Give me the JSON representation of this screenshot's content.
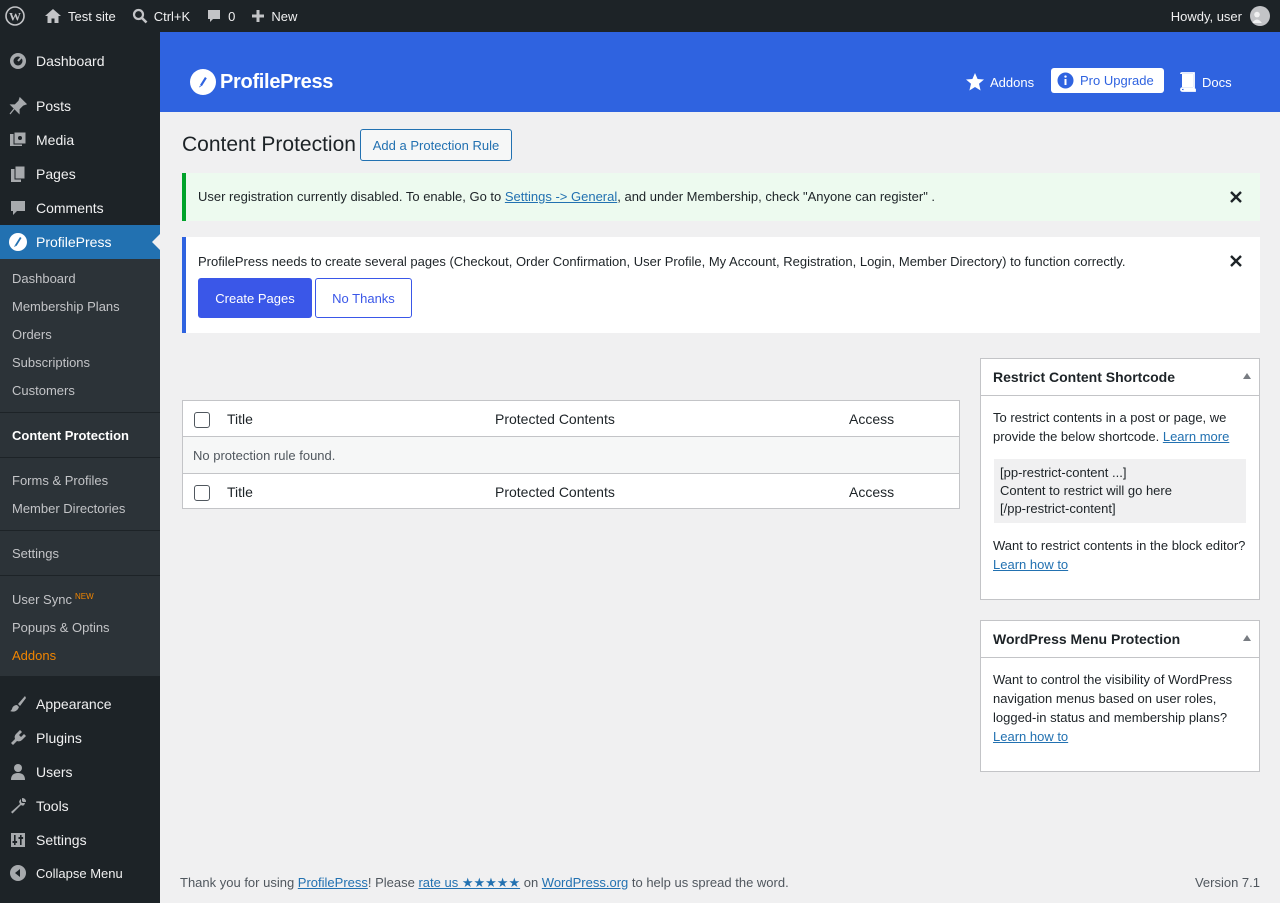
{
  "adminbar": {
    "site_name": "Test site",
    "search_shortcut": "Ctrl+K",
    "comments_count": "0",
    "new_label": "New",
    "greeting": "Howdy, user"
  },
  "sidebar": {
    "items": [
      {
        "label": "Dashboard"
      },
      {
        "label": "Posts"
      },
      {
        "label": "Media"
      },
      {
        "label": "Pages"
      },
      {
        "label": "Comments"
      },
      {
        "label": "ProfilePress"
      },
      {
        "label": "Appearance"
      },
      {
        "label": "Plugins"
      },
      {
        "label": "Users"
      },
      {
        "label": "Tools"
      },
      {
        "label": "Settings"
      },
      {
        "label": "Collapse Menu"
      }
    ],
    "submenu": [
      {
        "label": "Dashboard"
      },
      {
        "label": "Membership Plans"
      },
      {
        "label": "Orders"
      },
      {
        "label": "Subscriptions"
      },
      {
        "label": "Customers"
      },
      {
        "label": "Content Protection"
      },
      {
        "label": "Forms & Profiles"
      },
      {
        "label": "Member Directories"
      },
      {
        "label": "Settings"
      },
      {
        "label": "User Sync"
      },
      {
        "label": "Popups & Optins"
      },
      {
        "label": "Addons"
      }
    ],
    "new_badge": "NEW"
  },
  "header": {
    "logo": "ProfilePress",
    "addons": "Addons",
    "pro_upgrade": "Pro Upgrade",
    "docs": "Docs"
  },
  "page": {
    "title": "Content Protection",
    "add_rule_button": "Add a Protection Rule"
  },
  "notices": {
    "registration": {
      "before": "User registration currently disabled. To enable, Go to ",
      "link": "Settings -> General",
      "after": ", and under Membership, check \"Anyone can register\" ."
    },
    "pages": {
      "text": "ProfilePress needs to create several pages (Checkout, Order Confirmation, User Profile, My Account, Registration, Login, Member Directory) to function correctly.",
      "create_button": "Create Pages",
      "no_thanks_button": "No Thanks"
    }
  },
  "table": {
    "columns": [
      "Title",
      "Protected Contents",
      "Access"
    ],
    "empty_message": "No protection rule found."
  },
  "shortcode_box": {
    "title": "Restrict Content Shortcode",
    "intro": "To restrict contents in a post or page, we provide the below shortcode.",
    "learn_more": "Learn more",
    "code_lines": [
      "[pp-restrict-content ...]",
      "Content to restrict will go here",
      "[/pp-restrict-content]"
    ],
    "block_text": "Want to restrict contents in the block editor?",
    "learn_how": "Learn how to"
  },
  "menu_box": {
    "title": "WordPress Menu Protection",
    "text": "Want to control the visibility of WordPress navigation menus based on user roles, logged-in status and membership plans?",
    "learn_how": "Learn how to"
  },
  "footer": {
    "text_1": "Thank you for using ",
    "link_1": "ProfilePress",
    "text_2": "! Please ",
    "link_2": "rate us ★★★★★",
    "text_3": " on ",
    "link_3": "WordPress.org",
    "text_4": " to help us spread the word.",
    "version": "Version 7.1"
  },
  "colors": {
    "admin_dark": "#1d2327",
    "wp_blue": "#2271b1",
    "profilepress_blue": "#2f63e0",
    "addons_orange": "#f18500",
    "success_green": "#00a32a"
  }
}
